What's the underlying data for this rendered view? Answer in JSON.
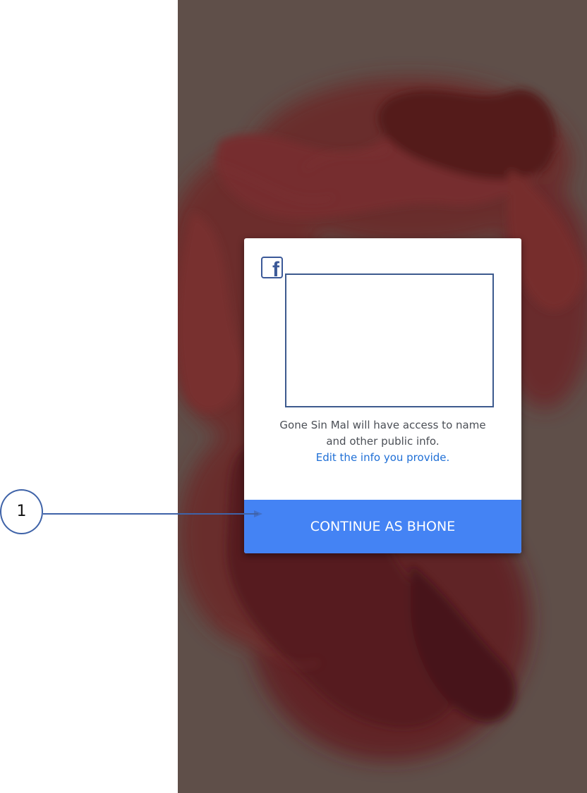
{
  "dialog": {
    "logo_icon": "facebook-logo-icon",
    "info_line1": "Gone Sin Mal will have access to name",
    "info_line2": "and other public info.",
    "edit_link": "Edit the info you provide.",
    "continue_label": "CONTINUE AS BHONE"
  },
  "annotation": {
    "marker_label": "1"
  },
  "colors": {
    "button": "#4483f4",
    "link": "#1f6fd6",
    "facebook": "#3b5998",
    "annotation": "#3f63a8"
  }
}
